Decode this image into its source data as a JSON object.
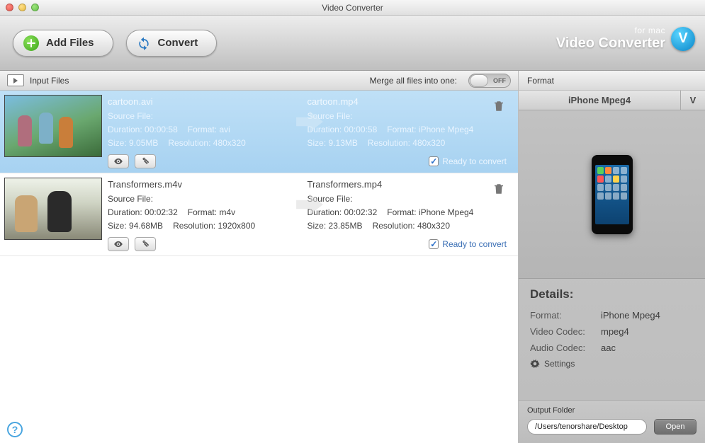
{
  "window": {
    "title": "Video Converter"
  },
  "toolbar": {
    "add_files": "Add Files",
    "convert": "Convert",
    "brand_line1": "for mac",
    "brand_line2": "Video Converter",
    "brand_letter": "V"
  },
  "leftHeader": {
    "input_files": "Input Files",
    "merge_label": "Merge all files into one:",
    "toggle_state": "OFF"
  },
  "files": [
    {
      "selected": true,
      "source": {
        "filename": "cartoon.avi",
        "source_file_label": "Source File:",
        "duration_label": "Duration:",
        "duration": "00:00:58",
        "format_label": "Format:",
        "format": "avi",
        "size_label": "Size:",
        "size": "9.05MB",
        "resolution_label": "Resolution:",
        "resolution": "480x320"
      },
      "target": {
        "filename": "cartoon.mp4",
        "source_file_label": "Source File:",
        "duration_label": "Duration:",
        "duration": "00:00:58",
        "format_label": "Format:",
        "format": "iPhone Mpeg4",
        "size_label": "Size:",
        "size": "9.13MB",
        "resolution_label": "Resolution:",
        "resolution": "480x320"
      },
      "ready_label": "Ready to convert"
    },
    {
      "selected": false,
      "source": {
        "filename": "Transformers.m4v",
        "source_file_label": "Source File:",
        "duration_label": "Duration:",
        "duration": "00:02:32",
        "format_label": "Format:",
        "format": "m4v",
        "size_label": "Size:",
        "size": "94.68MB",
        "resolution_label": "Resolution:",
        "resolution": "1920x800"
      },
      "target": {
        "filename": "Transformers.mp4",
        "source_file_label": "Source File:",
        "duration_label": "Duration:",
        "duration": "00:02:32",
        "format_label": "Format:",
        "format": "iPhone Mpeg4",
        "size_label": "Size:",
        "size": "23.85MB",
        "resolution_label": "Resolution:",
        "resolution": "480x320"
      },
      "ready_label": "Ready to convert"
    }
  ],
  "rightHeader": {
    "format": "Format"
  },
  "formatBar": {
    "selected": "iPhone Mpeg4",
    "drop": "V"
  },
  "details": {
    "heading": "Details:",
    "format_k": "Format:",
    "format_v": "iPhone Mpeg4",
    "video_codec_k": "Video Codec:",
    "video_codec_v": "mpeg4",
    "audio_codec_k": "Audio Codec:",
    "audio_codec_v": "aac",
    "settings": "Settings"
  },
  "output": {
    "label": "Output Folder",
    "path": "/Users/tenorshare/Desktop",
    "open": "Open"
  }
}
